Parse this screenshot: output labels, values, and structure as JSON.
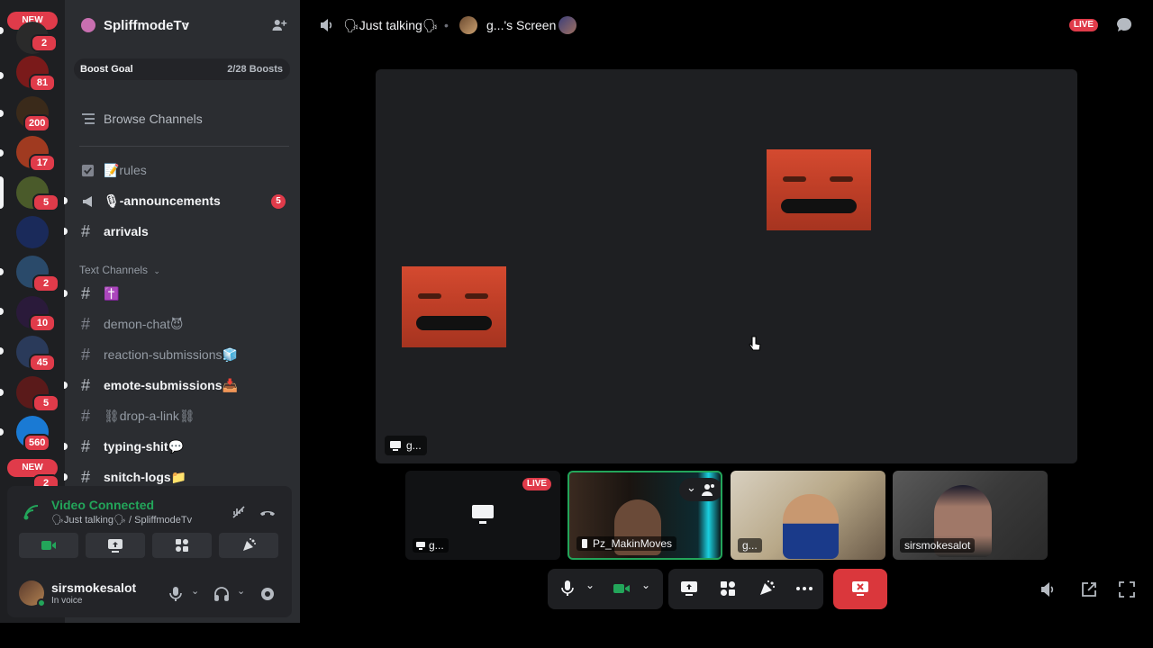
{
  "rail": {
    "new_top": "NEW",
    "new_bottom": "NEW",
    "servers": [
      {
        "name": "server-1",
        "badge": "2",
        "color": "#2a2a2a"
      },
      {
        "name": "server-2",
        "badge": "81",
        "color": "#7a1a1a"
      },
      {
        "name": "server-3",
        "badge": "200",
        "color": "#3a2a1a"
      },
      {
        "name": "server-4",
        "badge": "17",
        "color": "#a03a20"
      },
      {
        "name": "server-5",
        "badge": "5",
        "color": "#4a5a2a"
      },
      {
        "name": "server-6",
        "badge": "",
        "color": "#1a2a5a"
      },
      {
        "name": "server-7",
        "badge": "2",
        "color": "#2a4a6a"
      },
      {
        "name": "server-8",
        "badge": "10",
        "color": "#2a1a3a"
      },
      {
        "name": "server-9",
        "badge": "45",
        "color": "#2a3a5a"
      },
      {
        "name": "server-10",
        "badge": "5",
        "color": "#5a1a1a"
      },
      {
        "name": "server-11",
        "badge": "560",
        "color": "#1a7ad4"
      },
      {
        "name": "server-12",
        "badge": "2",
        "color": "#2a2a2a"
      }
    ]
  },
  "sidebar": {
    "guild_name": "SpliffmodeTv",
    "boost_label": "Boost Goal",
    "boost_count": "2/28 Boosts",
    "browse_label": "Browse Channels",
    "category": "Text Channels",
    "channels": [
      {
        "label": "📝rules",
        "icon": "rules-icon",
        "unread": false,
        "dot": false,
        "mention": ""
      },
      {
        "label": "🎙-announcements",
        "icon": "megaphone-icon",
        "unread": true,
        "dot": true,
        "mention": "5"
      },
      {
        "label": "arrivals",
        "icon": "hash-icon",
        "unread": true,
        "dot": true,
        "mention": ""
      },
      {
        "label": "✝️",
        "icon": "hash-icon",
        "unread": true,
        "dot": true,
        "mention": ""
      },
      {
        "label": "demon-chat😈",
        "icon": "hash-icon",
        "unread": false,
        "dot": false,
        "mention": ""
      },
      {
        "label": "reaction-submissions🧊",
        "icon": "hash-icon",
        "unread": false,
        "dot": false,
        "mention": ""
      },
      {
        "label": "emote-submissions📥",
        "icon": "hash-icon",
        "unread": true,
        "dot": true,
        "mention": ""
      },
      {
        "label": "⛓drop-a-link⛓",
        "icon": "hash-icon",
        "unread": false,
        "dot": false,
        "mention": ""
      },
      {
        "label": "typing-shit💬",
        "icon": "hash-icon",
        "unread": true,
        "dot": true,
        "mention": ""
      },
      {
        "label": "snitch-logs📁",
        "icon": "hash-icon",
        "unread": true,
        "dot": true,
        "mention": ""
      }
    ],
    "voice": {
      "title": "Video Connected",
      "subtitle": "🗣Just talking🗣 / SpliffmodeTv"
    },
    "user": {
      "name": "sirsmokesalot",
      "status": "In voice"
    }
  },
  "main": {
    "channel_name": "🗣Just talking🗣",
    "separator": "•",
    "screen_label": "g...'s Screen",
    "live_label": "LIVE",
    "stage_tag": "g...",
    "tiles": [
      {
        "label": "g...",
        "live": "LIVE",
        "active": false
      },
      {
        "label": "Pz_MakinMoves",
        "live": "",
        "active": true
      },
      {
        "label": "g...",
        "live": "",
        "active": false
      },
      {
        "label": "sirsmokesalot",
        "live": "",
        "active": false
      }
    ]
  },
  "colors": {
    "accent_green": "#23a55a",
    "live_red": "#e03b4a",
    "end_call_red": "#da373c"
  }
}
